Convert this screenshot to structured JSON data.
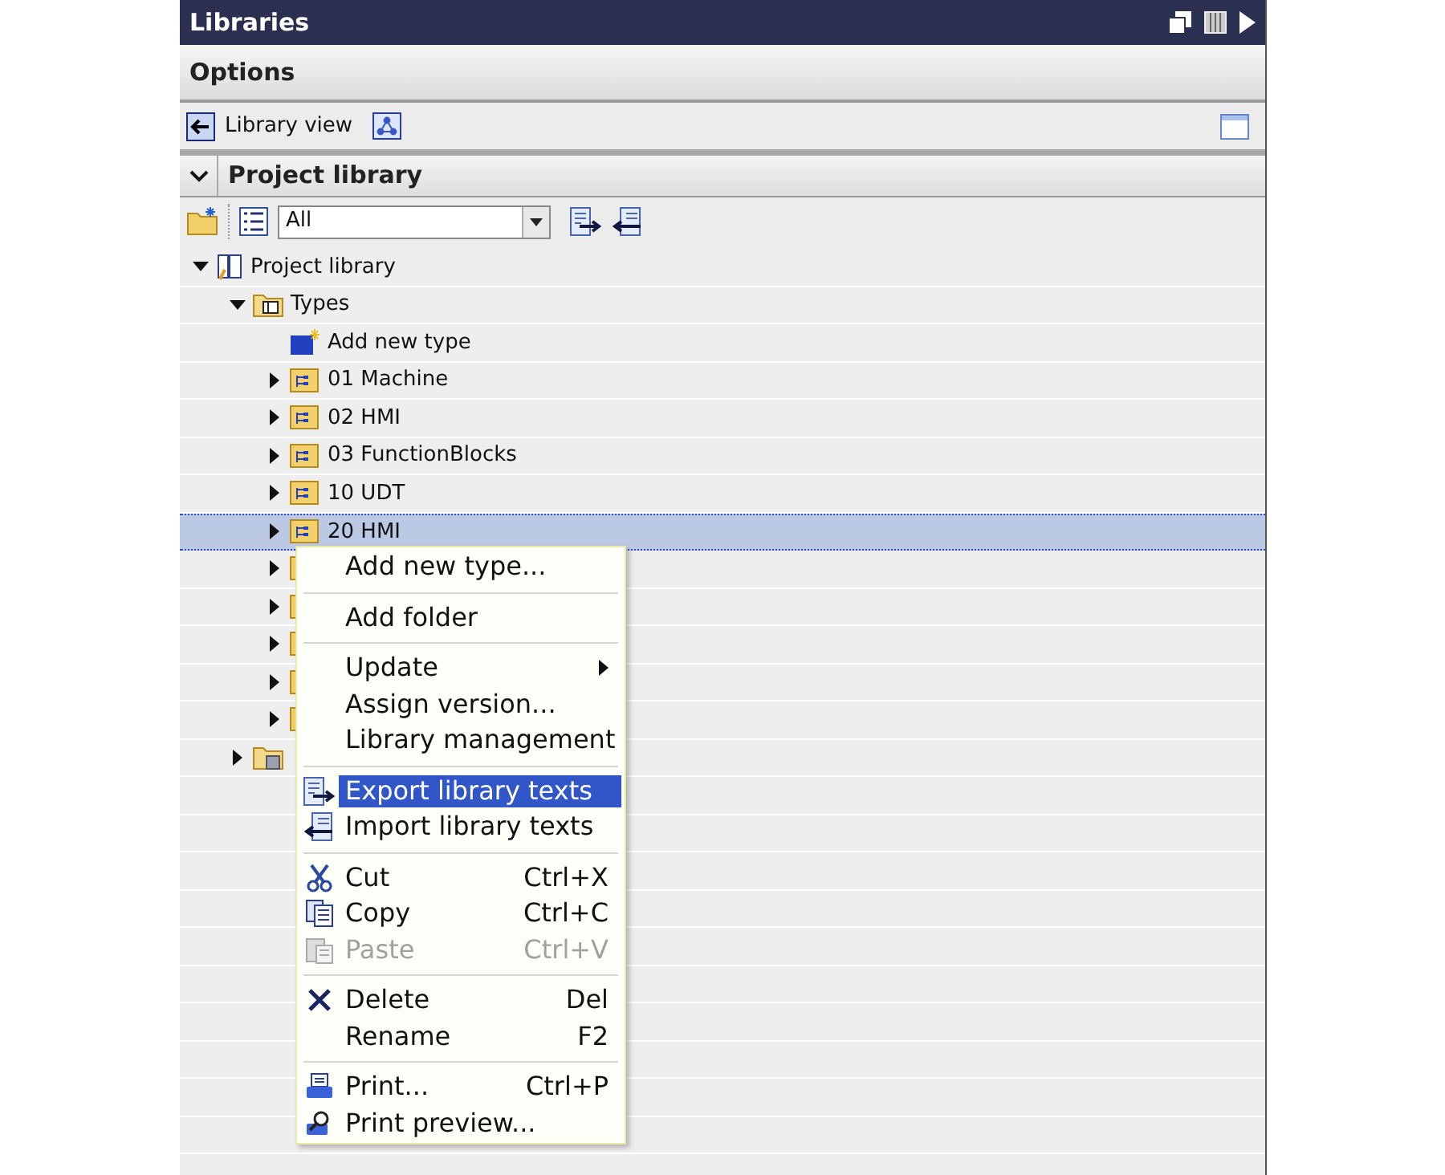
{
  "panel": {
    "title": "Libraries"
  },
  "options": {
    "title": "Options"
  },
  "toolbar": {
    "library_view": "Library view"
  },
  "project_library": {
    "title": "Project library",
    "expanded": true,
    "filter": {
      "value": "All"
    }
  },
  "tree": [
    {
      "label": "Project library",
      "kind": "library",
      "expanded": true,
      "selected": false,
      "children": [
        {
          "label": "Types",
          "kind": "types",
          "expanded": true,
          "selected": false,
          "children": [
            {
              "label": "Add new type",
              "kind": "add",
              "selected": false
            },
            {
              "label": "01 Machine",
              "kind": "folder",
              "expanded": false,
              "selected": false
            },
            {
              "label": "02 HMI",
              "kind": "folder",
              "expanded": false,
              "selected": false
            },
            {
              "label": "03 FunctionBlocks",
              "kind": "folder",
              "expanded": false,
              "selected": false
            },
            {
              "label": "10 UDT",
              "kind": "folder",
              "expanded": false,
              "selected": false
            },
            {
              "label": "20 HMI",
              "kind": "folder",
              "expanded": false,
              "selected": true
            },
            {
              "kind": "folder",
              "expanded": false,
              "selected": false
            },
            {
              "kind": "folder",
              "expanded": false,
              "selected": false
            },
            {
              "kind": "folder",
              "expanded": false,
              "selected": false
            },
            {
              "kind": "folder",
              "expanded": false,
              "selected": false
            },
            {
              "kind": "folder",
              "expanded": false,
              "selected": false
            }
          ]
        },
        {
          "kind": "master",
          "expanded": false,
          "selected": false
        }
      ]
    }
  ],
  "context_menu": {
    "groups": [
      [
        {
          "label": "Add new type...",
          "kind": "none",
          "disabled": false,
          "selected": false
        }
      ],
      [
        {
          "label": "Add folder",
          "kind": "none",
          "disabled": false,
          "selected": false
        }
      ],
      [
        {
          "label": "Update",
          "kind": "none",
          "disabled": false,
          "selected": false,
          "submenu": true
        },
        {
          "label": "Assign version...",
          "kind": "none",
          "disabled": false,
          "selected": false
        },
        {
          "label": "Library management",
          "kind": "none",
          "disabled": false,
          "selected": false
        }
      ],
      [
        {
          "label": "Export library texts",
          "kind": "export",
          "disabled": false,
          "selected": true
        },
        {
          "label": "Import library texts",
          "kind": "import",
          "disabled": false,
          "selected": false
        }
      ],
      [
        {
          "label": "Cut",
          "shortcut": "Ctrl+X",
          "kind": "cut",
          "disabled": false,
          "selected": false
        },
        {
          "label": "Copy",
          "shortcut": "Ctrl+C",
          "kind": "copy",
          "disabled": false,
          "selected": false
        },
        {
          "label": "Paste",
          "shortcut": "Ctrl+V",
          "kind": "paste",
          "disabled": true,
          "selected": false
        }
      ],
      [
        {
          "label": "Delete",
          "shortcut": "Del",
          "kind": "delete",
          "disabled": false,
          "selected": false
        },
        {
          "label": "Rename",
          "shortcut": "F2",
          "kind": "none",
          "disabled": false,
          "selected": false
        }
      ],
      [
        {
          "label": "Print...",
          "shortcut": "Ctrl+P",
          "kind": "print",
          "disabled": false,
          "selected": false
        },
        {
          "label": "Print preview...",
          "kind": "preview",
          "disabled": false,
          "selected": false
        }
      ]
    ]
  }
}
